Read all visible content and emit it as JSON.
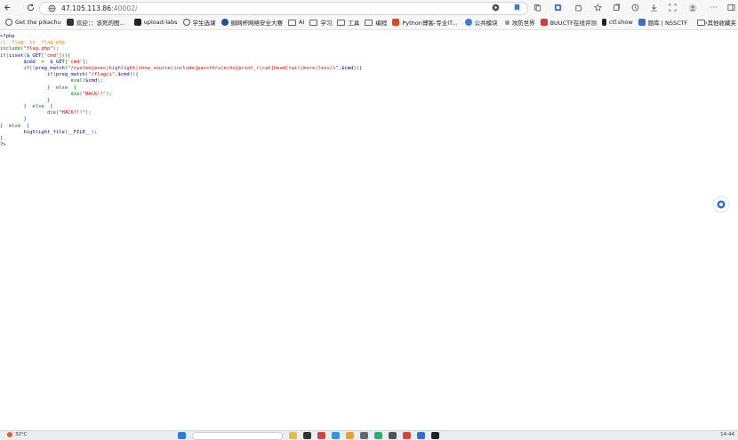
{
  "address_bar": {
    "url_host": "47.105.113.86",
    "url_port": ":40002/"
  },
  "bookmarks": [
    {
      "label": "Get the pikachu",
      "color": "#3b6fd1"
    },
    {
      "label": "欢迎：：该死的图...",
      "color": "#333333"
    },
    {
      "label": "upload-labs",
      "color": "#222222"
    },
    {
      "label": "学生选课",
      "color": "#2a7be0"
    },
    {
      "label": "御网杯网络安全大赛",
      "color": "#1f4fa5"
    },
    {
      "label": "AI",
      "color": "#6a6a6a"
    },
    {
      "label": "学习",
      "color": "#6a6a6a"
    },
    {
      "label": "工具",
      "color": "#6a6a6a"
    },
    {
      "label": "编程",
      "color": "#6a6a6a"
    },
    {
      "label": "Python博客-专业IT...",
      "color": "#e0452b"
    },
    {
      "label": "公共模块",
      "color": "#3b7be0"
    },
    {
      "label": "攻防世界",
      "color": "#666666"
    },
    {
      "label": "BUUCTF在线评测",
      "color": "#d83a3a"
    },
    {
      "label": "ctf.show",
      "color": "#222222"
    },
    {
      "label": "题库 | NSSCTF",
      "color": "#3a6fd1"
    }
  ],
  "bookmarks_more": "›",
  "bookmarks_other": "其他收藏夹",
  "code_lines": [
    [
      {
        "t": "<?php",
        "c": "blue"
      }
    ],
    [
      {
        "t": "//  flag  in  flag.php",
        "c": "orange"
      }
    ],
    [
      {
        "t": "include",
        "c": "green"
      },
      {
        "t": "(",
        "c": "green"
      },
      {
        "t": "\"flag.php\"",
        "c": "red"
      },
      {
        "t": ");",
        "c": "green"
      }
    ],
    [
      {
        "t": "if",
        "c": "green"
      },
      {
        "t": "(",
        "c": "green"
      },
      {
        "t": "isset",
        "c": "blue"
      },
      {
        "t": "(",
        "c": "green"
      },
      {
        "t": "$_GET",
        "c": "blue"
      },
      {
        "t": "[",
        "c": "green"
      },
      {
        "t": "'cmd'",
        "c": "red"
      },
      {
        "t": "])){",
        "c": "green"
      }
    ],
    [
      {
        "t": "        $cmd  ",
        "c": "blue"
      },
      {
        "t": "=  ",
        "c": "green"
      },
      {
        "t": "$_GET",
        "c": "blue"
      },
      {
        "t": "[",
        "c": "green"
      },
      {
        "t": "'cmd'",
        "c": "red"
      },
      {
        "t": "];",
        "c": "green"
      }
    ],
    [
      {
        "t": "        if",
        "c": "green"
      },
      {
        "t": "(!",
        "c": "green"
      },
      {
        "t": "preg_match",
        "c": "blue"
      },
      {
        "t": "(",
        "c": "green"
      },
      {
        "t": "\"/system|exec|highlight|show_source|include|passthru|echo|print_r|cat|head|tail|more|less/i\"",
        "c": "red"
      },
      {
        "t": ",",
        "c": "green"
      },
      {
        "t": "$cmd",
        "c": "blue"
      },
      {
        "t": ")){",
        "c": "green"
      }
    ],
    [
      {
        "t": "                if",
        "c": "green"
      },
      {
        "t": "(",
        "c": "green"
      },
      {
        "t": "preg_match",
        "c": "blue"
      },
      {
        "t": "(",
        "c": "green"
      },
      {
        "t": "\"/flag/i\"",
        "c": "red"
      },
      {
        "t": ",",
        "c": "green"
      },
      {
        "t": "$cmd",
        "c": "blue"
      },
      {
        "t": ")){",
        "c": "green"
      }
    ],
    [
      {
        "t": "                        eval",
        "c": "green"
      },
      {
        "t": "(",
        "c": "green"
      },
      {
        "t": "$cmd",
        "c": "blue"
      },
      {
        "t": ");",
        "c": "green"
      }
    ],
    [
      {
        "t": "                }  else  {",
        "c": "green"
      }
    ],
    [
      {
        "t": "                        die",
        "c": "green"
      },
      {
        "t": "(",
        "c": "green"
      },
      {
        "t": "\"HACK!!\"",
        "c": "red"
      },
      {
        "t": ");",
        "c": "green"
      }
    ],
    [
      {
        "t": "                }",
        "c": "green"
      }
    ],
    [
      {
        "t": "        }  else  {",
        "c": "green"
      }
    ],
    [
      {
        "t": "                die",
        "c": "green"
      },
      {
        "t": "(",
        "c": "green"
      },
      {
        "t": "\"HACK!!!\"",
        "c": "red"
      },
      {
        "t": ");",
        "c": "green"
      }
    ],
    [
      {
        "t": "        }",
        "c": "green"
      }
    ],
    [
      {
        "t": "}  else  {",
        "c": "green"
      }
    ],
    [
      {
        "t": "        highlight_file",
        "c": "blue"
      },
      {
        "t": "(",
        "c": "green"
      },
      {
        "t": "__FILE__",
        "c": "blue"
      },
      {
        "t": ");",
        "c": "green"
      }
    ],
    [
      {
        "t": "}",
        "c": "green"
      }
    ],
    [
      {
        "t": "?>",
        "c": "blue"
      }
    ]
  ],
  "taskbar": {
    "weather": "32°C",
    "clock": "14:44"
  },
  "icons": {
    "back": "back-arrow-icon",
    "refresh": "refresh-icon",
    "site_info": "globe-icon"
  }
}
